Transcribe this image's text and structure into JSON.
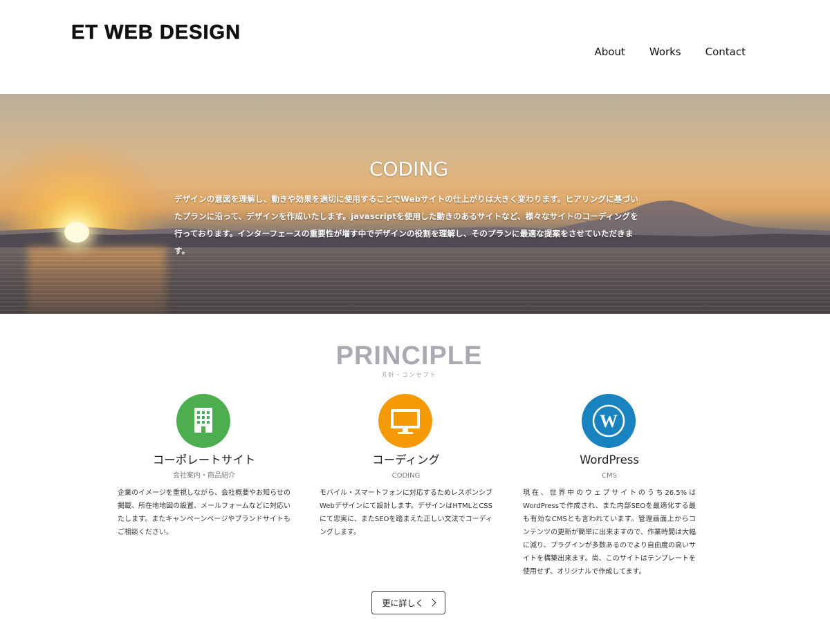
{
  "header": {
    "logo": "ET WEB DESIGN",
    "nav": [
      {
        "label": "About"
      },
      {
        "label": "Works"
      },
      {
        "label": "Contact"
      }
    ]
  },
  "hero": {
    "title": "CODING",
    "text": "デザインの意図を理解し、動きや効果を適切に使用することでWebサイトの仕上がりは大きく変わります。ヒアリングに基づいたプランに沿って、デザインを作成いたします。javascriptを使用した動きのあるサイトなど、様々なサイトのコーディングを行っております。インターフェースの重要性が増す中でデザインの役割を理解し、そのプランに最適な提案をさせていただきます。"
  },
  "principle": {
    "title": "PRINCIPLE",
    "subtitle": "方針・コンセプト",
    "cards": [
      {
        "icon": "building-icon",
        "color": "#4cae4f",
        "title": "コーポレートサイト",
        "subtitle": "会社案内・商品紹介",
        "text": "企業のイメージを重視しながら、会社概要やお知らせの掲載、所在地地図の設置、メールフォームなどに対応いたします。またキャンペーンページやブランドサイトもご相談ください。"
      },
      {
        "icon": "monitor-icon",
        "color": "#f59a07",
        "title": "コーディング",
        "subtitle": "CODING",
        "text": "モバイル・スマートフォンに対応するためレスポンシブWebデザインにて設計します。デザインはHTMLとCSSにて忠実に、またSEOを踏まえた正しい文法でコーディングします。"
      },
      {
        "icon": "wordpress-icon",
        "color": "#1883bf",
        "title": "WordPress",
        "subtitle": "CMS",
        "text": "現在、世界中のウェブサイトのうち26.5%はWordPressで作成され、また内部SEOを最適化する最も有効なCMSとも言われています。管理画面上からコンテンツの更新が簡単に出来ますので、作業時間は大幅に減り、プラグインが多数あるのでより自由度の高いサイトを構築出来ます。尚、このサイトはテンプレートを使用せず、オリジナルで作成してます。"
      }
    ],
    "more_button": "更に詳しく"
  }
}
